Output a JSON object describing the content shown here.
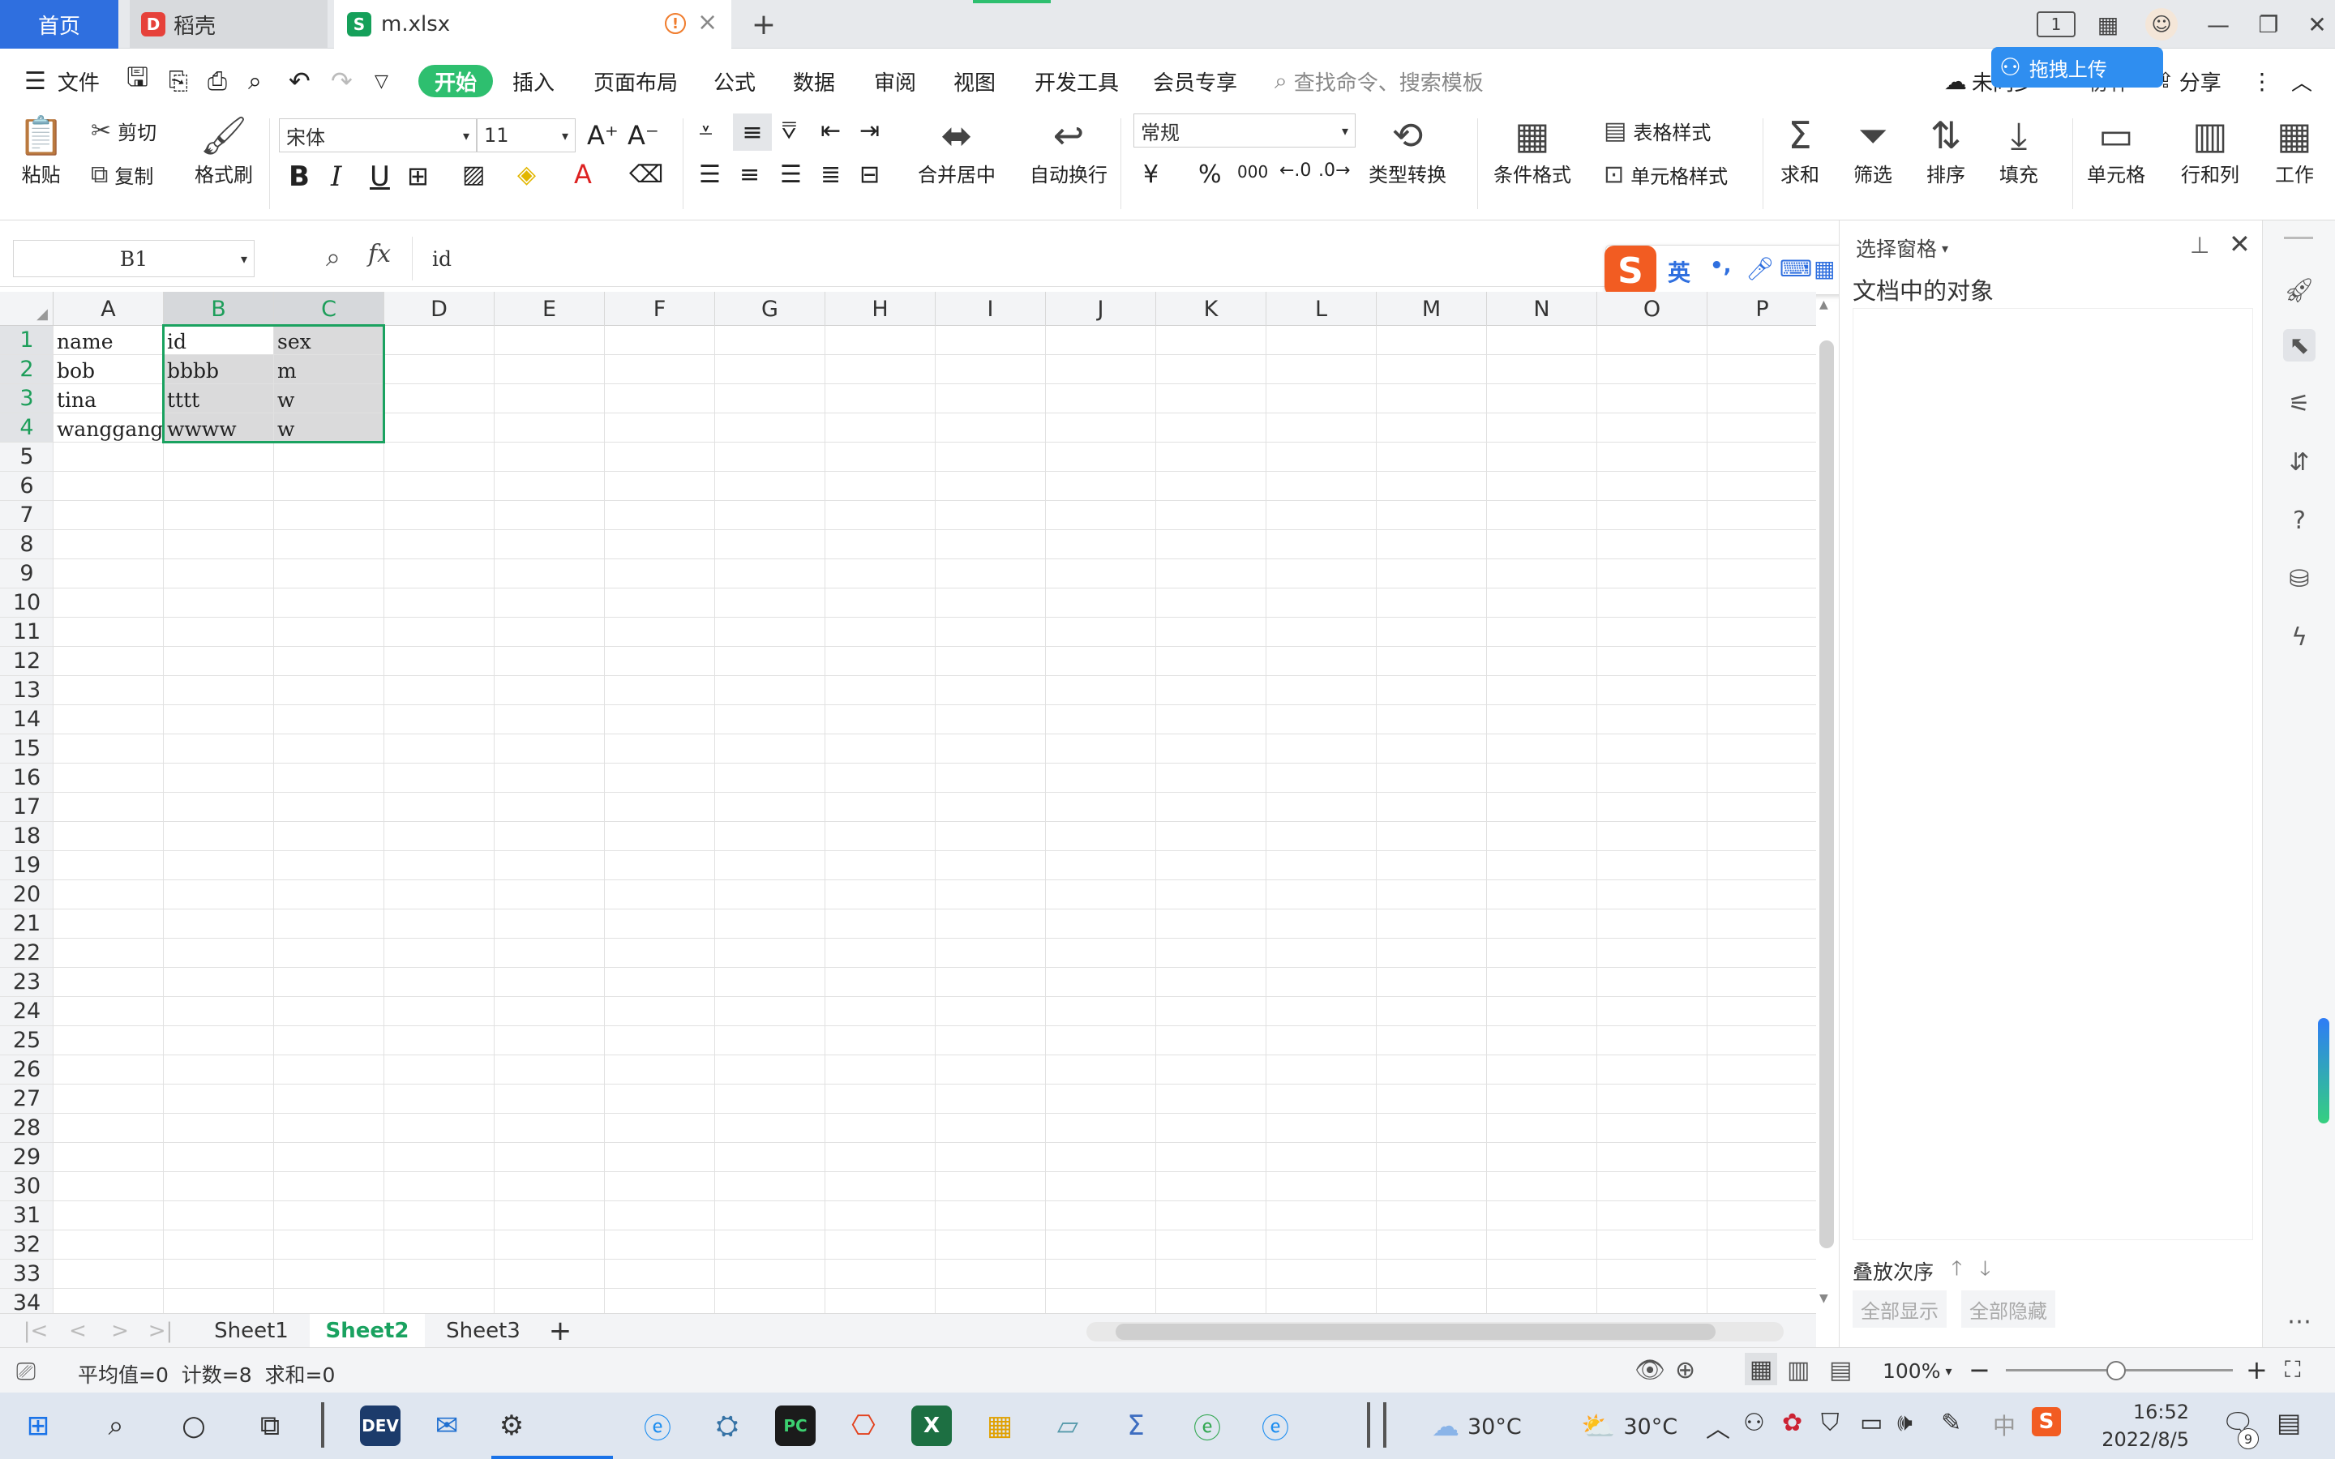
{
  "titlebar": {
    "tabs": [
      {
        "label": "首页"
      },
      {
        "label": "稻壳"
      },
      {
        "label": "m.xlsx"
      }
    ],
    "new_tab": "+",
    "page_badge": "1",
    "minimize": "—",
    "restore": "❐",
    "close": "✕"
  },
  "ribbon_tabs": {
    "menu_label": "文件",
    "items": [
      "开始",
      "插入",
      "页面布局",
      "公式",
      "数据",
      "审阅",
      "视图",
      "开发工具",
      "会员专享"
    ],
    "search_placeholder": "查找命令、搜索模板",
    "sync_label": "未同步",
    "collab_label": "协作",
    "share_label": "分享",
    "upload_label": "拖拽上传"
  },
  "ribbon": {
    "paste": "粘贴",
    "cut": "剪切",
    "copy": "复制",
    "format_painter": "格式刷",
    "font_name": "宋体",
    "font_size": "11",
    "bold": "B",
    "italic": "I",
    "underline": "U",
    "merge_center": "合并居中",
    "wrap_text": "自动换行",
    "number_format": "常规",
    "currency": "¥",
    "percent": "%",
    "thousands": "000",
    "type_convert": "类型转换",
    "conditional_format": "条件格式",
    "table_style": "表格样式",
    "cell_style": "单元格样式",
    "sum": "求和",
    "filter": "筛选",
    "sort": "排序",
    "fill": "填充",
    "cell": "单元格",
    "row_col": "行和列",
    "worksheet": "工作"
  },
  "formula_bar": {
    "name_box": "B1",
    "fx": "fx",
    "content": "id"
  },
  "ime": {
    "mode": "英",
    "punct": "•,"
  },
  "grid": {
    "columns": [
      "A",
      "B",
      "C",
      "D",
      "E",
      "F",
      "G",
      "H",
      "I",
      "J",
      "K",
      "L",
      "M",
      "N",
      "O",
      "P"
    ],
    "rows": [
      "1",
      "2",
      "3",
      "4",
      "5",
      "6",
      "7",
      "8",
      "9",
      "10",
      "11",
      "12",
      "13",
      "14",
      "15",
      "16",
      "17",
      "18",
      "19",
      "20",
      "21",
      "22",
      "23",
      "24",
      "25",
      "26",
      "27",
      "28",
      "29",
      "30",
      "31",
      "32",
      "33",
      "34"
    ],
    "cells": [
      [
        "name",
        "id",
        "sex"
      ],
      [
        "bob",
        "bbbb",
        "m"
      ],
      [
        "tina",
        "tttt",
        "w"
      ],
      [
        "wanggang",
        "wwww",
        "w"
      ]
    ],
    "selection": "B1:C4"
  },
  "right_pane": {
    "title": "选择窗格",
    "subtitle": "文档中的对象",
    "order_label": "叠放次序",
    "show_all": "全部显示",
    "hide_all": "全部隐藏"
  },
  "sheets": {
    "tabs": [
      "Sheet1",
      "Sheet2",
      "Sheet3"
    ],
    "active": "Sheet2",
    "add": "+"
  },
  "statusbar": {
    "stats": "平均值=0  计数=8  求和=0",
    "zoom": "100%"
  },
  "taskbar": {
    "weather1": "30°C",
    "weather2": "30°C",
    "time": "16:52",
    "date": "2022/8/5",
    "notif": "9",
    "ime_lang": "中"
  },
  "colors": {
    "accent_green": "#1aa260",
    "start_tab": "#2ebf6f",
    "home_tab": "#2f6fdf"
  }
}
